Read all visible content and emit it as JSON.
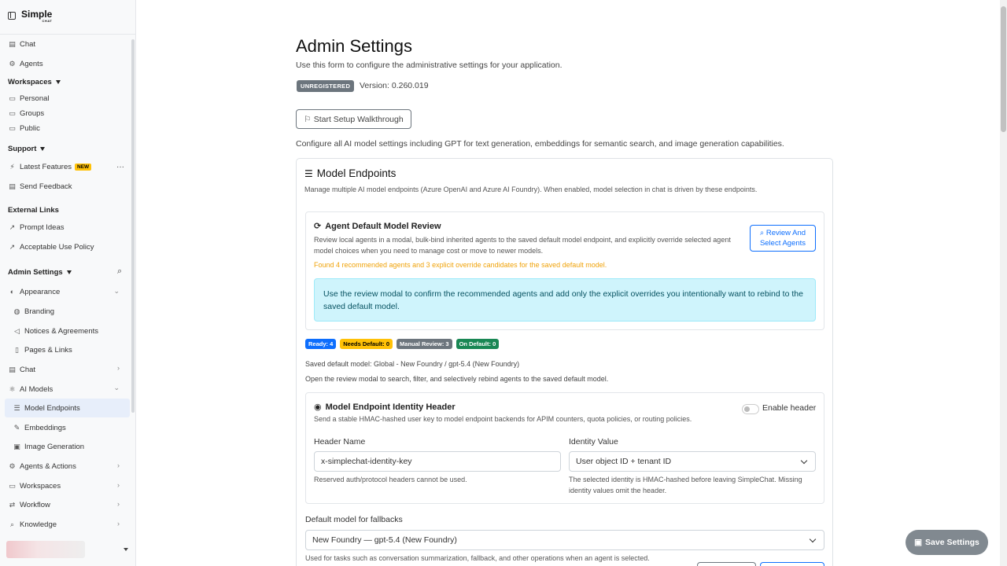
{
  "sidebar": {
    "logo": "Simple",
    "logo_sub": "CHAT",
    "chat": "Chat",
    "agents": "Agents",
    "workspaces_head": "Workspaces",
    "personal": "Personal",
    "groups": "Groups",
    "public": "Public",
    "support_head": "Support",
    "latest_features": "Latest Features",
    "new_badge": "NEW",
    "send_feedback": "Send Feedback",
    "external_head": "External Links",
    "prompt_ideas": "Prompt Ideas",
    "acceptable_use": "Acceptable Use Policy",
    "admin_head": "Admin Settings",
    "appearance": "Appearance",
    "branding": "Branding",
    "notices": "Notices & Agreements",
    "pages_links": "Pages & Links",
    "admin_chat": "Chat",
    "ai_models": "AI Models",
    "model_endpoints": "Model Endpoints",
    "embeddings": "Embeddings",
    "image_generation": "Image Generation",
    "agents_actions": "Agents & Actions",
    "admin_workspaces": "Workspaces",
    "workflow": "Workflow",
    "knowledge": "Knowledge"
  },
  "page": {
    "title": "Admin Settings",
    "subtitle": "Use this form to configure the administrative settings for your application.",
    "unregistered": "UNREGISTERED",
    "version": "Version: 0.260.019",
    "walkthrough_btn": "Start Setup Walkthrough",
    "config_text": "Configure all AI model settings including GPT for text generation, embeddings for semantic search, and image generation capabilities."
  },
  "endpoints": {
    "title": "Model Endpoints",
    "subtitle": "Manage multiple AI model endpoints (Azure OpenAI and Azure AI Foundry). When enabled, model selection in chat is driven by these endpoints."
  },
  "review": {
    "title": "Agent Default Model Review",
    "desc": "Review local agents in a modal, bulk-bind inherited agents to the saved default model endpoint, and explicitly override selected agent model choices when you need to manage cost or move to newer models.",
    "warning": "Found 4 recommended agents and 3 explicit override candidates for the saved default model.",
    "button": "Review And Select Agents",
    "info": "Use the review modal to confirm the recommended agents and add only the explicit overrides you intentionally want to rebind to the saved default model."
  },
  "badges": {
    "ready": "Ready: 4",
    "needs_default": "Needs Default: 0",
    "manual_review": "Manual Review: 3",
    "on_default": "On Default: 0",
    "colors": {
      "ready": "#0d6efd",
      "needs_default": "#ffc107",
      "manual_review": "#6c757d",
      "on_default": "#198754"
    }
  },
  "saved_model": "Saved default model: Global - New Foundry / gpt-5.4 (New Foundry)",
  "open_review": "Open the review modal to search, filter, and selectively rebind agents to the saved default model.",
  "identity": {
    "title": "Model Endpoint Identity Header",
    "desc": "Send a stable HMAC-hashed user key to model endpoint backends for APIM counters, quota policies, or routing policies.",
    "toggle_label": "Enable header",
    "header_name_label": "Header Name",
    "header_name_value": "x-simplechat-identity-key",
    "header_help": "Reserved auth/protocol headers cannot be used.",
    "identity_label": "Identity Value",
    "identity_value": "User object ID + tenant ID",
    "identity_help": "The selected identity is HMAC-hashed before leaving SimpleChat. Missing identity values omit the header."
  },
  "fallback": {
    "label": "Default model for fallbacks",
    "value": "New Foundry — gpt-5.4 (New Foundry)",
    "help": "Used for tasks such as conversation summarization, fallback, and other operations when an agent is selected."
  },
  "save_btn": "Save Settings"
}
